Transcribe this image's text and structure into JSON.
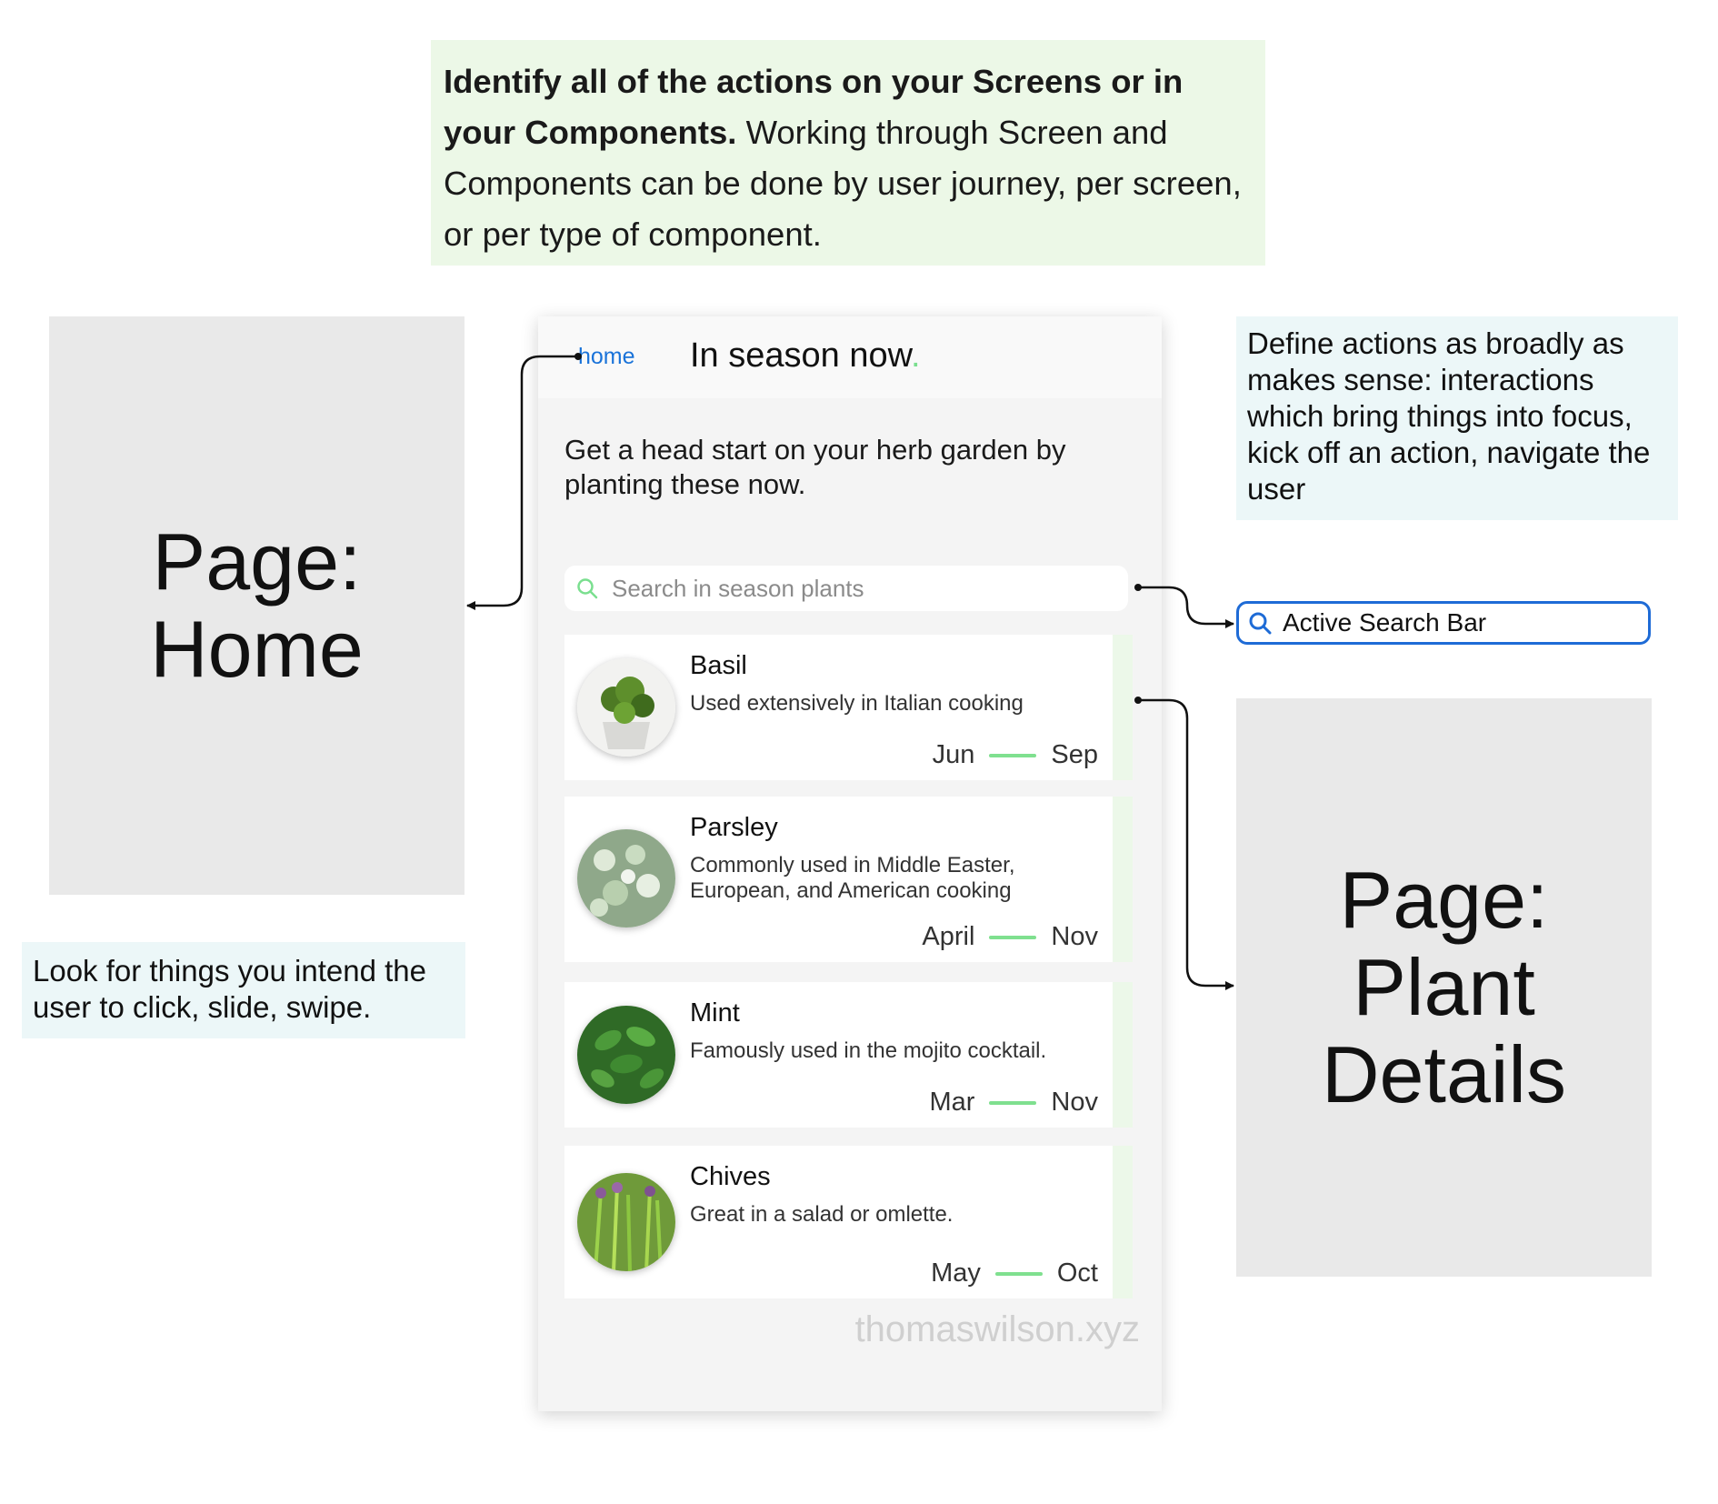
{
  "top_note": {
    "bold": "Identify all of the actions on your Screens or in your Components.",
    "text": " Working through Screen and Components can be done by user journey, per screen, or per type of component."
  },
  "page_home": {
    "line1": "Page:",
    "line2": "Home"
  },
  "page_details": {
    "line1": "Page:",
    "line2": "Plant",
    "line3": "Details"
  },
  "note_define": "Define actions as broadly as makes sense: interactions which bring things into focus, kick off an action, navigate the user",
  "note_look": "Look for things you intend the user to click, slide, swipe.",
  "active_search": {
    "label": "Active Search Bar"
  },
  "phone": {
    "home_link": "home",
    "title": "In season now",
    "title_dot": ".",
    "intro": "Get a head start on your herb garden by planting these now.",
    "search_placeholder": "Search in season plants",
    "plants": [
      {
        "name": "Basil",
        "desc": "Used extensively in Italian cooking",
        "start": "Jun",
        "end": "Sep"
      },
      {
        "name": "Parsley",
        "desc": "Commonly used in Middle Easter, European, and American cooking",
        "start": "April",
        "end": "Nov"
      },
      {
        "name": "Mint",
        "desc": "Famously used in the mojito cocktail.",
        "start": "Mar",
        "end": "Nov"
      },
      {
        "name": "Chives",
        "desc": "Great in a salad or omlette.",
        "start": "May",
        "end": "Oct"
      }
    ],
    "watermark": "thomaswilson.xyz"
  },
  "colors": {
    "accent_green": "#7fe08f",
    "link_blue": "#1a73d9",
    "active_border": "#1e6bd6"
  }
}
